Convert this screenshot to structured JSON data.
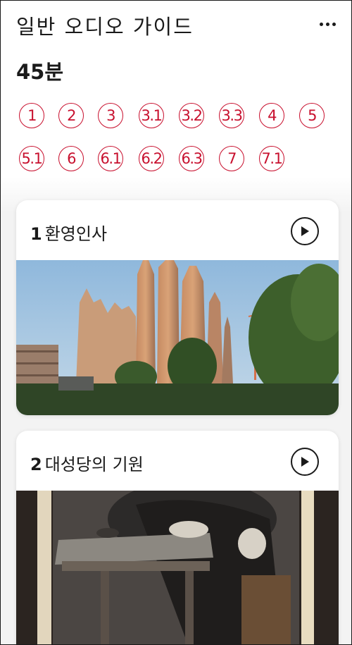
{
  "header": {
    "title": "일반 오디오 가이드",
    "more_icon": "more-horizontal-icon"
  },
  "duration": "45분",
  "chapters": [
    "1",
    "2",
    "3",
    "3.1",
    "3.2",
    "3.3",
    "4",
    "5",
    "5.1",
    "6",
    "6.1",
    "6.2",
    "6.3",
    "7",
    "7.1"
  ],
  "colors": {
    "accent": "#c8102e"
  },
  "cards": [
    {
      "number": "1",
      "title": "환영인사",
      "icon": "play-icon",
      "image": "sagrada-familia-facade"
    },
    {
      "number": "2",
      "title": "대성당의 기원",
      "icon": "play-icon",
      "image": "painting-man-writing-at-desk"
    }
  ]
}
